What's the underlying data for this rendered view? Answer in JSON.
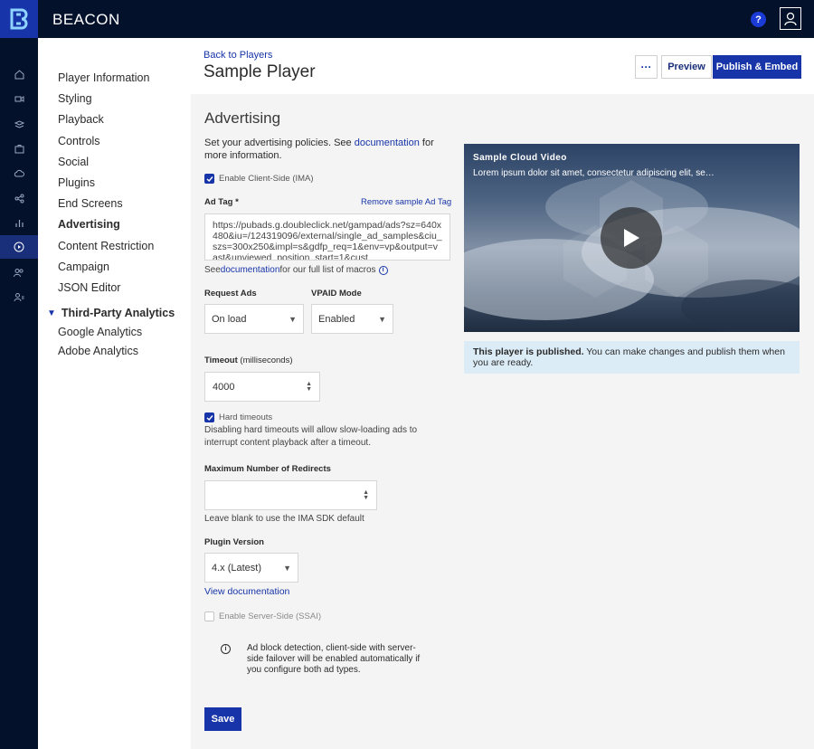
{
  "app": {
    "brand": "BEACON",
    "help_label": "?",
    "colors": {
      "topbar": "#04112b",
      "accent": "#1734a8",
      "published_bg": "#dcecf7"
    }
  },
  "rail": {
    "icons": [
      "home-icon",
      "video-icon",
      "layers-icon",
      "briefcase-icon",
      "cloud-icon",
      "share-icon",
      "analytics-icon",
      "player-icon",
      "users-icon",
      "user-settings-icon"
    ],
    "active": "player-icon"
  },
  "nav": {
    "items": [
      {
        "label": "Player Information"
      },
      {
        "label": "Styling"
      },
      {
        "label": "Playback"
      },
      {
        "label": "Controls"
      },
      {
        "label": "Social"
      },
      {
        "label": "Plugins"
      },
      {
        "label": "End Screens"
      },
      {
        "label": "Advertising",
        "active": true
      },
      {
        "label": "Content Restriction"
      },
      {
        "label": "Campaign"
      },
      {
        "label": "JSON Editor"
      }
    ],
    "group": {
      "label": "Third-Party Analytics",
      "items": [
        {
          "label": "Google Analytics"
        },
        {
          "label": "Adobe Analytics"
        }
      ]
    }
  },
  "header": {
    "back_link": "Back to Players",
    "title": "Sample Player",
    "more_label": "···",
    "preview_label": "Preview",
    "publish_label": "Publish & Embed"
  },
  "advertising": {
    "title": "Advertising",
    "intro_prefix": "Set your advertising policies. See ",
    "intro_link": "documentation",
    "intro_suffix": " for more information.",
    "client_side_label": "Enable Client-Side (IMA)",
    "client_side_checked": true,
    "ad_tag_label": "Ad Tag *",
    "remove_sample_label": "Remove sample Ad Tag",
    "ad_tag_value": "https://pubads.g.doubleclick.net/gampad/ads?sz=640x480&iu=/124319096/external/single_ad_samples&ciu_szs=300x250&impl=s&gdfp_req=1&env=vp&output=vast&unviewed_position_start=1&cust",
    "macros_prefix": "See ",
    "macros_link": "documentation",
    "macros_suffix": " for our full list of macros",
    "request_ads_label": "Request Ads",
    "request_ads_value": "On load",
    "vpaid_label": "VPAID Mode",
    "vpaid_value": "Enabled",
    "timeout_label": "Timeout",
    "timeout_unit": "(milliseconds)",
    "timeout_value": "4000",
    "hard_timeouts_label": "Hard timeouts",
    "hard_timeouts_checked": true,
    "hard_timeouts_help": "Disabling hard timeouts will allow slow-loading ads to interrupt content playback after a timeout.",
    "max_redirects_label": "Maximum Number of Redirects",
    "max_redirects_value": "",
    "max_redirects_help": "Leave blank to use the IMA SDK default",
    "plugin_version_label": "Plugin Version",
    "plugin_version_value": "4.x (Latest)",
    "view_docs_label": "View documentation",
    "server_side_label": "Enable Server-Side (SSAI)",
    "server_side_checked": false,
    "ad_block_note": "Ad block detection, client-side with server-side failover will be enabled automatically if you configure both ad types.",
    "save_label": "Save"
  },
  "preview": {
    "video_title": "Sample Cloud Video",
    "video_description": "Lorem ipsum dolor sit amet, consectetur adipiscing elit, se…",
    "published_bold": "This player is published.",
    "published_rest": " You can make changes and publish them when you are ready."
  }
}
